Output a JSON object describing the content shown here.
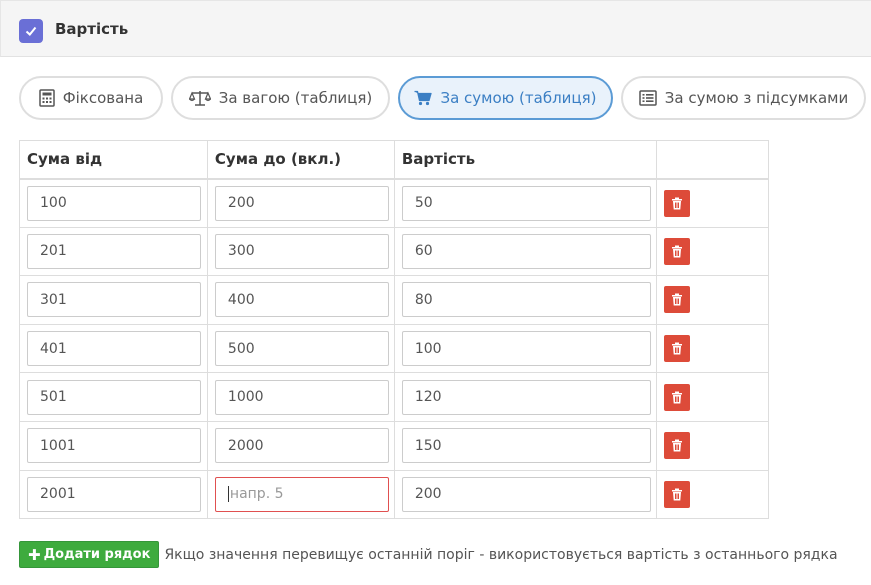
{
  "header": {
    "title": "Вартість",
    "checkbox_checked": true
  },
  "tabs": [
    {
      "label": "Фіксована",
      "icon": "calculator-icon",
      "active": false
    },
    {
      "label": "За вагою (таблиця)",
      "icon": "balance-scale-icon",
      "active": false
    },
    {
      "label": "За сумою (таблиця)",
      "icon": "cart-icon",
      "active": true
    },
    {
      "label": "За сумою з підсумками",
      "icon": "list-alt-icon",
      "active": false
    }
  ],
  "table": {
    "columns": [
      "Сума від",
      "Сума до (вкл.)",
      "Вартість",
      ""
    ],
    "rows": [
      {
        "from": "100",
        "to": "200",
        "cost": "50"
      },
      {
        "from": "201",
        "to": "300",
        "cost": "60"
      },
      {
        "from": "301",
        "to": "400",
        "cost": "80"
      },
      {
        "from": "401",
        "to": "500",
        "cost": "100"
      },
      {
        "from": "501",
        "to": "1000",
        "cost": "120"
      },
      {
        "from": "1001",
        "to": "2000",
        "cost": "150"
      },
      {
        "from": "2001",
        "to": "",
        "cost": "200",
        "to_placeholder": "напр. 5"
      }
    ]
  },
  "footer": {
    "add_label": "Додати рядок",
    "hint": "Якщо значення перевищує останній поріг - використовується вартість з останнього рядка"
  },
  "colors": {
    "accent": "#6a6fd6",
    "active_tab": "#5b9bd5",
    "delete": "#dd4b39",
    "add": "#3eab3e"
  }
}
